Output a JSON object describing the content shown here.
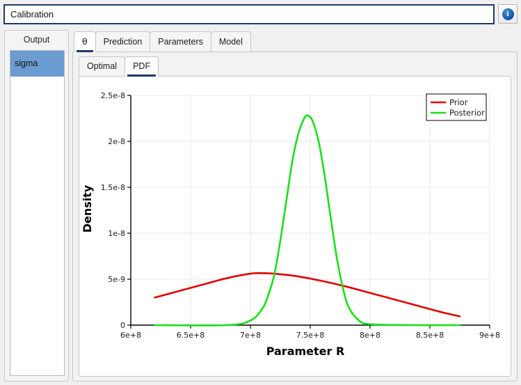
{
  "window": {
    "title_value": "Calibration",
    "info_icon_label": "i"
  },
  "sidebar": {
    "header": "Output",
    "items": [
      {
        "label": "sigma",
        "selected": true
      }
    ]
  },
  "tabs": {
    "outer": [
      {
        "label": "θ",
        "active": true
      },
      {
        "label": "Prediction",
        "active": false
      },
      {
        "label": "Parameters",
        "active": false
      },
      {
        "label": "Model",
        "active": false
      }
    ],
    "inner": [
      {
        "label": "Optimal",
        "active": false
      },
      {
        "label": "PDF",
        "active": true
      }
    ]
  },
  "chart_data": {
    "type": "line",
    "title": "",
    "xlabel": "Parameter R",
    "ylabel": "Density",
    "xlim": [
      600000000,
      900000000
    ],
    "ylim": [
      0,
      2.5e-08
    ],
    "grid": true,
    "legend_position": "top-right",
    "xticks": [
      600000000,
      650000000,
      700000000,
      750000000,
      800000000,
      850000000,
      900000000
    ],
    "xtick_labels": [
      "6e+8",
      "6.5e+8",
      "7e+8",
      "7.5e+8",
      "8e+8",
      "8.5e+8",
      "9e+8"
    ],
    "yticks": [
      0,
      5e-09,
      1e-08,
      1.5e-08,
      2e-08,
      2.5e-08
    ],
    "ytick_labels": [
      "0",
      "5e-9",
      "1e-8",
      "1.5e-8",
      "2e-8",
      "2.5e-8"
    ],
    "series": [
      {
        "name": "Prior",
        "color": "#e00000",
        "x": [
          620000000,
          640000000,
          660000000,
          680000000,
          700000000,
          710000000,
          720000000,
          740000000,
          760000000,
          780000000,
          800000000,
          820000000,
          840000000,
          860000000,
          875000000
        ],
        "y": [
          3e-09,
          3.7e-09,
          4.4e-09,
          5.1e-09,
          5.6e-09,
          5.65e-09,
          5.6e-09,
          5.3e-09,
          4.8e-09,
          4.2e-09,
          3.5e-09,
          2.8e-09,
          2.1e-09,
          1.4e-09,
          9.5e-10
        ]
      },
      {
        "name": "Posterior",
        "color": "#18e018",
        "x": [
          620000000,
          680000000,
          700000000,
          710000000,
          715000000,
          720000000,
          725000000,
          730000000,
          735000000,
          740000000,
          745000000,
          748000000,
          752000000,
          757000000,
          762000000,
          767000000,
          772000000,
          777000000,
          782000000,
          790000000,
          800000000,
          840000000,
          875000000
        ],
        "y": [
          0,
          0,
          5e-10,
          1.8e-09,
          3.3e-09,
          5.5e-09,
          9.2e-09,
          1.35e-08,
          1.78e-08,
          2.08e-08,
          2.25e-08,
          2.28e-08,
          2.22e-08,
          2e-08,
          1.63e-08,
          1.18e-08,
          7.5e-09,
          4.2e-09,
          2e-09,
          6e-10,
          1e-10,
          0,
          0
        ]
      }
    ]
  }
}
